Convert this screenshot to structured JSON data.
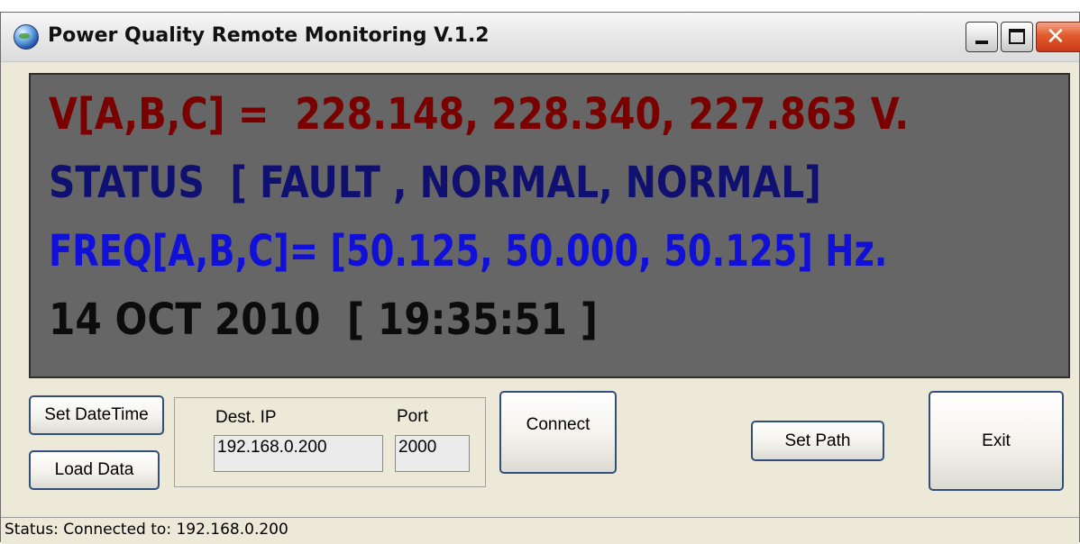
{
  "window": {
    "title": "Power Quality Remote Monitoring V.1.2",
    "icon": "globe-icon",
    "controls": {
      "minimize": "minimize-icon",
      "maximize": "maximize-icon",
      "close": "close-icon",
      "close_glyph": "✕"
    }
  },
  "display": {
    "background": "#666666",
    "voltage_line": "V[A,B,C] =  228.148, 228.340, 227.863 V.",
    "status_line": "STATUS  [ FAULT , NORMAL, NORMAL]",
    "frequency_line": "FREQ[A,B,C]= [50.125, 50.000, 50.125] Hz.",
    "datetime_line": "14 OCT 2010  [ 19:35:51 ]",
    "colors": {
      "voltage": "#7a0000",
      "status": "#101070",
      "frequency": "#1010d8",
      "datetime": "#0c0c0c"
    }
  },
  "controls": {
    "set_datetime_label": "Set DateTime",
    "load_data_label": "Load Data",
    "dest_ip_label": "Dest. IP",
    "dest_ip_value": "192.168.0.200",
    "port_label": "Port",
    "port_value": "2000",
    "connect_label": "Connect",
    "set_path_label": "Set Path",
    "exit_label": "Exit"
  },
  "statusbar": {
    "text": "Status: Connected to: 192.168.0.200"
  }
}
